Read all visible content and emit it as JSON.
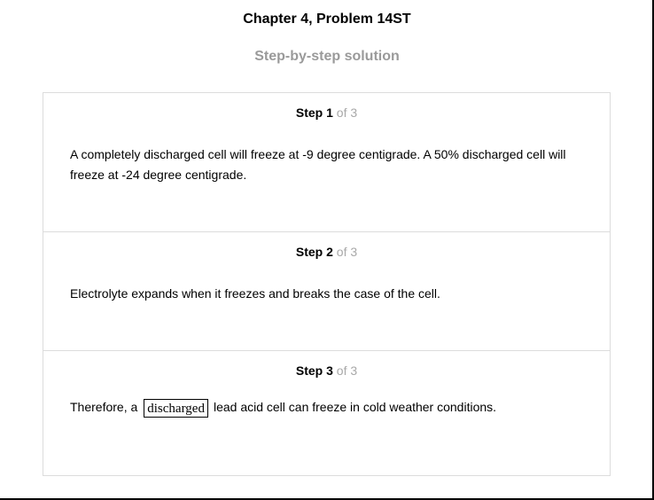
{
  "header": {
    "title": "Chapter 4, Problem 14ST",
    "subtitle": "Step-by-step solution"
  },
  "steps": [
    {
      "label": "Step",
      "number": "1",
      "total": "of 3",
      "text": "A completely discharged cell will freeze at -9 degree centigrade. A 50% discharged cell will freeze at -24 degree centigrade."
    },
    {
      "label": "Step",
      "number": "2",
      "total": "of 3",
      "text": "Electrolyte expands when it freezes and breaks the case of the cell."
    },
    {
      "label": "Step",
      "number": "3",
      "total": "of 3",
      "text_before": "Therefore, a",
      "answer": "discharged",
      "text_after": "lead acid cell can freeze in cold weather conditions."
    }
  ]
}
